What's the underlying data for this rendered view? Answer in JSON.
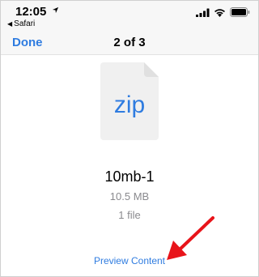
{
  "status_bar": {
    "time": "12:05",
    "back_app": "Safari",
    "icons": [
      "location-arrow-icon",
      "cellular-signal-icon",
      "wifi-icon",
      "battery-icon"
    ]
  },
  "nav": {
    "done_label": "Done",
    "pager": "2 of 3"
  },
  "file": {
    "icon_label": "zip",
    "name": "10mb-1",
    "size": "10.5 MB",
    "count": "1 file"
  },
  "actions": {
    "preview_label": "Preview Content"
  },
  "colors": {
    "accent": "#2f7ce0",
    "secondary_text": "#8a8a8e",
    "annotation_arrow": "#e8141a"
  }
}
